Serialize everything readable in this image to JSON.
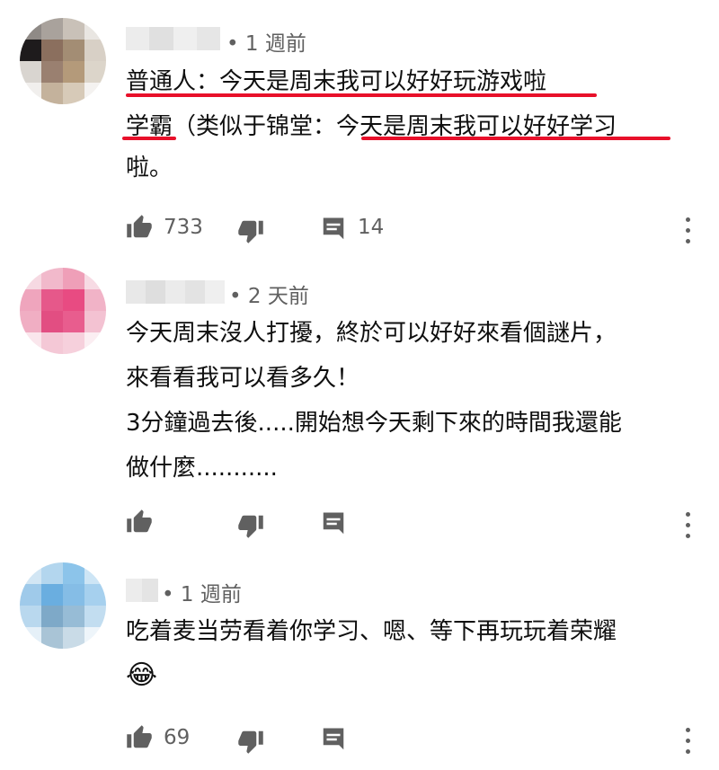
{
  "comments": [
    {
      "time": "• 1 週前",
      "lines": [
        "普通人：今天是周末我可以好好玩游戏啦",
        "学霸（类似于锦堂：今天是周末我可以好好学习",
        "啦。"
      ],
      "likes": "733",
      "replies": "14"
    },
    {
      "time": "• 2 天前",
      "lines": [
        "今天周末沒人打擾，終於可以好好來看個謎片，",
        "來看看我可以看多久！",
        "3分鐘過去後.....開始想今天剩下來的時間我還能",
        "做什麼..........."
      ],
      "likes": "",
      "replies": ""
    },
    {
      "time": "• 1 週前",
      "lines": [
        "吃着麦当劳看着你学习、嗯、等下再玩玩着荣耀"
      ],
      "emoji": "😂",
      "likes": "69",
      "replies": ""
    }
  ],
  "icons": {
    "like": "thumb-up-icon",
    "dislike": "thumb-down-icon",
    "reply": "reply-icon",
    "more": "more-vert-icon"
  },
  "colors": {
    "underline": "#e8102a",
    "meta": "#606060"
  }
}
